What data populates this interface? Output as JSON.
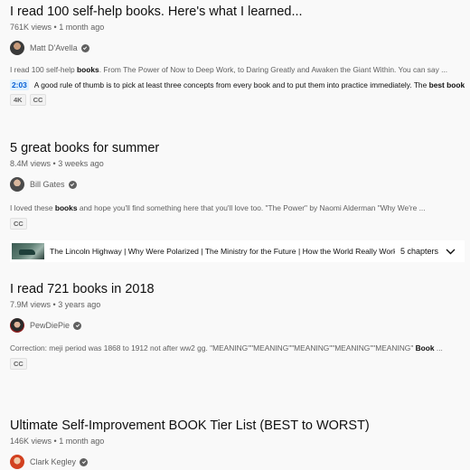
{
  "results": [
    {
      "title": "I read 100 self-help books. Here's what I learned...",
      "views": "761K views",
      "age": "1 month ago",
      "channel": "Matt D'Avella",
      "snippet_pre": "I read 100 self-help ",
      "snippet_bold": "books",
      "snippet_post": ". From The Power of Now to Deep Work, to Daring Greatly and Awaken the Giant Within. You can say ...",
      "moment_time": "2:03",
      "moment_pre": "A good rule of thumb is to pick at least three concepts from every book and to put them into practice immediately. The ",
      "moment_bold": "best book",
      "badges": [
        "4K",
        "CC"
      ]
    },
    {
      "title": "5 great books for summer",
      "views": "8.4M views",
      "age": "3 weeks ago",
      "channel": "Bill Gates",
      "snippet_pre": "I loved these ",
      "snippet_bold": "books",
      "snippet_post": " and hope you'll find something here that you'll love too. \"The Power\" by Naomi Alderman \"Why We're ...",
      "badges": [
        "CC"
      ],
      "chapters_text": "The Lincoln Highway | Why Were Polarized | The Ministry for the Future | How the World Really Works ...",
      "chapters_count": "5 chapters"
    },
    {
      "title": "I read 721 books in 2018",
      "views": "7.9M views",
      "age": "3 years ago",
      "channel": "PewDiePie",
      "snippet_pre": "Correction: meji period was 1868 to 1912 not after ww2 gg. \"MEANING\"\"MEANING\"\"MEANING\"\"MEANING\"\"MEANING\" ",
      "snippet_bold": "Book",
      "snippet_post": " ...",
      "badges": [
        "CC"
      ]
    },
    {
      "title": "Ultimate Self-Improvement BOOK Tier List (BEST to WORST)",
      "views": "146K views",
      "age": "1 month ago",
      "channel": "Clark Kegley"
    }
  ],
  "separator": "•",
  "icons": {
    "verified": "verified-check-icon",
    "chevron": "chevron-down-icon"
  },
  "colors": {
    "link_blue": "#065fd4",
    "timestamp_bg": "#def1ff"
  }
}
